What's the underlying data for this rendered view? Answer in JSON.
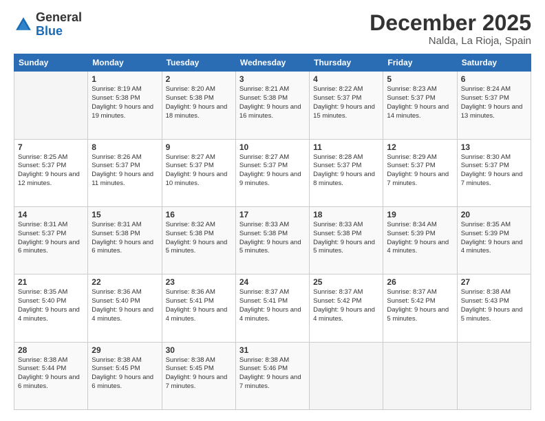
{
  "logo": {
    "general": "General",
    "blue": "Blue"
  },
  "header": {
    "month": "December 2025",
    "location": "Nalda, La Rioja, Spain"
  },
  "weekdays": [
    "Sunday",
    "Monday",
    "Tuesday",
    "Wednesday",
    "Thursday",
    "Friday",
    "Saturday"
  ],
  "weeks": [
    [
      {
        "day": "",
        "sunrise": "",
        "sunset": "",
        "daylight": ""
      },
      {
        "day": "1",
        "sunrise": "Sunrise: 8:19 AM",
        "sunset": "Sunset: 5:38 PM",
        "daylight": "Daylight: 9 hours and 19 minutes."
      },
      {
        "day": "2",
        "sunrise": "Sunrise: 8:20 AM",
        "sunset": "Sunset: 5:38 PM",
        "daylight": "Daylight: 9 hours and 18 minutes."
      },
      {
        "day": "3",
        "sunrise": "Sunrise: 8:21 AM",
        "sunset": "Sunset: 5:38 PM",
        "daylight": "Daylight: 9 hours and 16 minutes."
      },
      {
        "day": "4",
        "sunrise": "Sunrise: 8:22 AM",
        "sunset": "Sunset: 5:37 PM",
        "daylight": "Daylight: 9 hours and 15 minutes."
      },
      {
        "day": "5",
        "sunrise": "Sunrise: 8:23 AM",
        "sunset": "Sunset: 5:37 PM",
        "daylight": "Daylight: 9 hours and 14 minutes."
      },
      {
        "day": "6",
        "sunrise": "Sunrise: 8:24 AM",
        "sunset": "Sunset: 5:37 PM",
        "daylight": "Daylight: 9 hours and 13 minutes."
      }
    ],
    [
      {
        "day": "7",
        "sunrise": "Sunrise: 8:25 AM",
        "sunset": "Sunset: 5:37 PM",
        "daylight": "Daylight: 9 hours and 12 minutes."
      },
      {
        "day": "8",
        "sunrise": "Sunrise: 8:26 AM",
        "sunset": "Sunset: 5:37 PM",
        "daylight": "Daylight: 9 hours and 11 minutes."
      },
      {
        "day": "9",
        "sunrise": "Sunrise: 8:27 AM",
        "sunset": "Sunset: 5:37 PM",
        "daylight": "Daylight: 9 hours and 10 minutes."
      },
      {
        "day": "10",
        "sunrise": "Sunrise: 8:27 AM",
        "sunset": "Sunset: 5:37 PM",
        "daylight": "Daylight: 9 hours and 9 minutes."
      },
      {
        "day": "11",
        "sunrise": "Sunrise: 8:28 AM",
        "sunset": "Sunset: 5:37 PM",
        "daylight": "Daylight: 9 hours and 8 minutes."
      },
      {
        "day": "12",
        "sunrise": "Sunrise: 8:29 AM",
        "sunset": "Sunset: 5:37 PM",
        "daylight": "Daylight: 9 hours and 7 minutes."
      },
      {
        "day": "13",
        "sunrise": "Sunrise: 8:30 AM",
        "sunset": "Sunset: 5:37 PM",
        "daylight": "Daylight: 9 hours and 7 minutes."
      }
    ],
    [
      {
        "day": "14",
        "sunrise": "Sunrise: 8:31 AM",
        "sunset": "Sunset: 5:37 PM",
        "daylight": "Daylight: 9 hours and 6 minutes."
      },
      {
        "day": "15",
        "sunrise": "Sunrise: 8:31 AM",
        "sunset": "Sunset: 5:38 PM",
        "daylight": "Daylight: 9 hours and 6 minutes."
      },
      {
        "day": "16",
        "sunrise": "Sunrise: 8:32 AM",
        "sunset": "Sunset: 5:38 PM",
        "daylight": "Daylight: 9 hours and 5 minutes."
      },
      {
        "day": "17",
        "sunrise": "Sunrise: 8:33 AM",
        "sunset": "Sunset: 5:38 PM",
        "daylight": "Daylight: 9 hours and 5 minutes."
      },
      {
        "day": "18",
        "sunrise": "Sunrise: 8:33 AM",
        "sunset": "Sunset: 5:38 PM",
        "daylight": "Daylight: 9 hours and 5 minutes."
      },
      {
        "day": "19",
        "sunrise": "Sunrise: 8:34 AM",
        "sunset": "Sunset: 5:39 PM",
        "daylight": "Daylight: 9 hours and 4 minutes."
      },
      {
        "day": "20",
        "sunrise": "Sunrise: 8:35 AM",
        "sunset": "Sunset: 5:39 PM",
        "daylight": "Daylight: 9 hours and 4 minutes."
      }
    ],
    [
      {
        "day": "21",
        "sunrise": "Sunrise: 8:35 AM",
        "sunset": "Sunset: 5:40 PM",
        "daylight": "Daylight: 9 hours and 4 minutes."
      },
      {
        "day": "22",
        "sunrise": "Sunrise: 8:36 AM",
        "sunset": "Sunset: 5:40 PM",
        "daylight": "Daylight: 9 hours and 4 minutes."
      },
      {
        "day": "23",
        "sunrise": "Sunrise: 8:36 AM",
        "sunset": "Sunset: 5:41 PM",
        "daylight": "Daylight: 9 hours and 4 minutes."
      },
      {
        "day": "24",
        "sunrise": "Sunrise: 8:37 AM",
        "sunset": "Sunset: 5:41 PM",
        "daylight": "Daylight: 9 hours and 4 minutes."
      },
      {
        "day": "25",
        "sunrise": "Sunrise: 8:37 AM",
        "sunset": "Sunset: 5:42 PM",
        "daylight": "Daylight: 9 hours and 4 minutes."
      },
      {
        "day": "26",
        "sunrise": "Sunrise: 8:37 AM",
        "sunset": "Sunset: 5:42 PM",
        "daylight": "Daylight: 9 hours and 5 minutes."
      },
      {
        "day": "27",
        "sunrise": "Sunrise: 8:38 AM",
        "sunset": "Sunset: 5:43 PM",
        "daylight": "Daylight: 9 hours and 5 minutes."
      }
    ],
    [
      {
        "day": "28",
        "sunrise": "Sunrise: 8:38 AM",
        "sunset": "Sunset: 5:44 PM",
        "daylight": "Daylight: 9 hours and 6 minutes."
      },
      {
        "day": "29",
        "sunrise": "Sunrise: 8:38 AM",
        "sunset": "Sunset: 5:45 PM",
        "daylight": "Daylight: 9 hours and 6 minutes."
      },
      {
        "day": "30",
        "sunrise": "Sunrise: 8:38 AM",
        "sunset": "Sunset: 5:45 PM",
        "daylight": "Daylight: 9 hours and 7 minutes."
      },
      {
        "day": "31",
        "sunrise": "Sunrise: 8:38 AM",
        "sunset": "Sunset: 5:46 PM",
        "daylight": "Daylight: 9 hours and 7 minutes."
      },
      {
        "day": "",
        "sunrise": "",
        "sunset": "",
        "daylight": ""
      },
      {
        "day": "",
        "sunrise": "",
        "sunset": "",
        "daylight": ""
      },
      {
        "day": "",
        "sunrise": "",
        "sunset": "",
        "daylight": ""
      }
    ]
  ]
}
